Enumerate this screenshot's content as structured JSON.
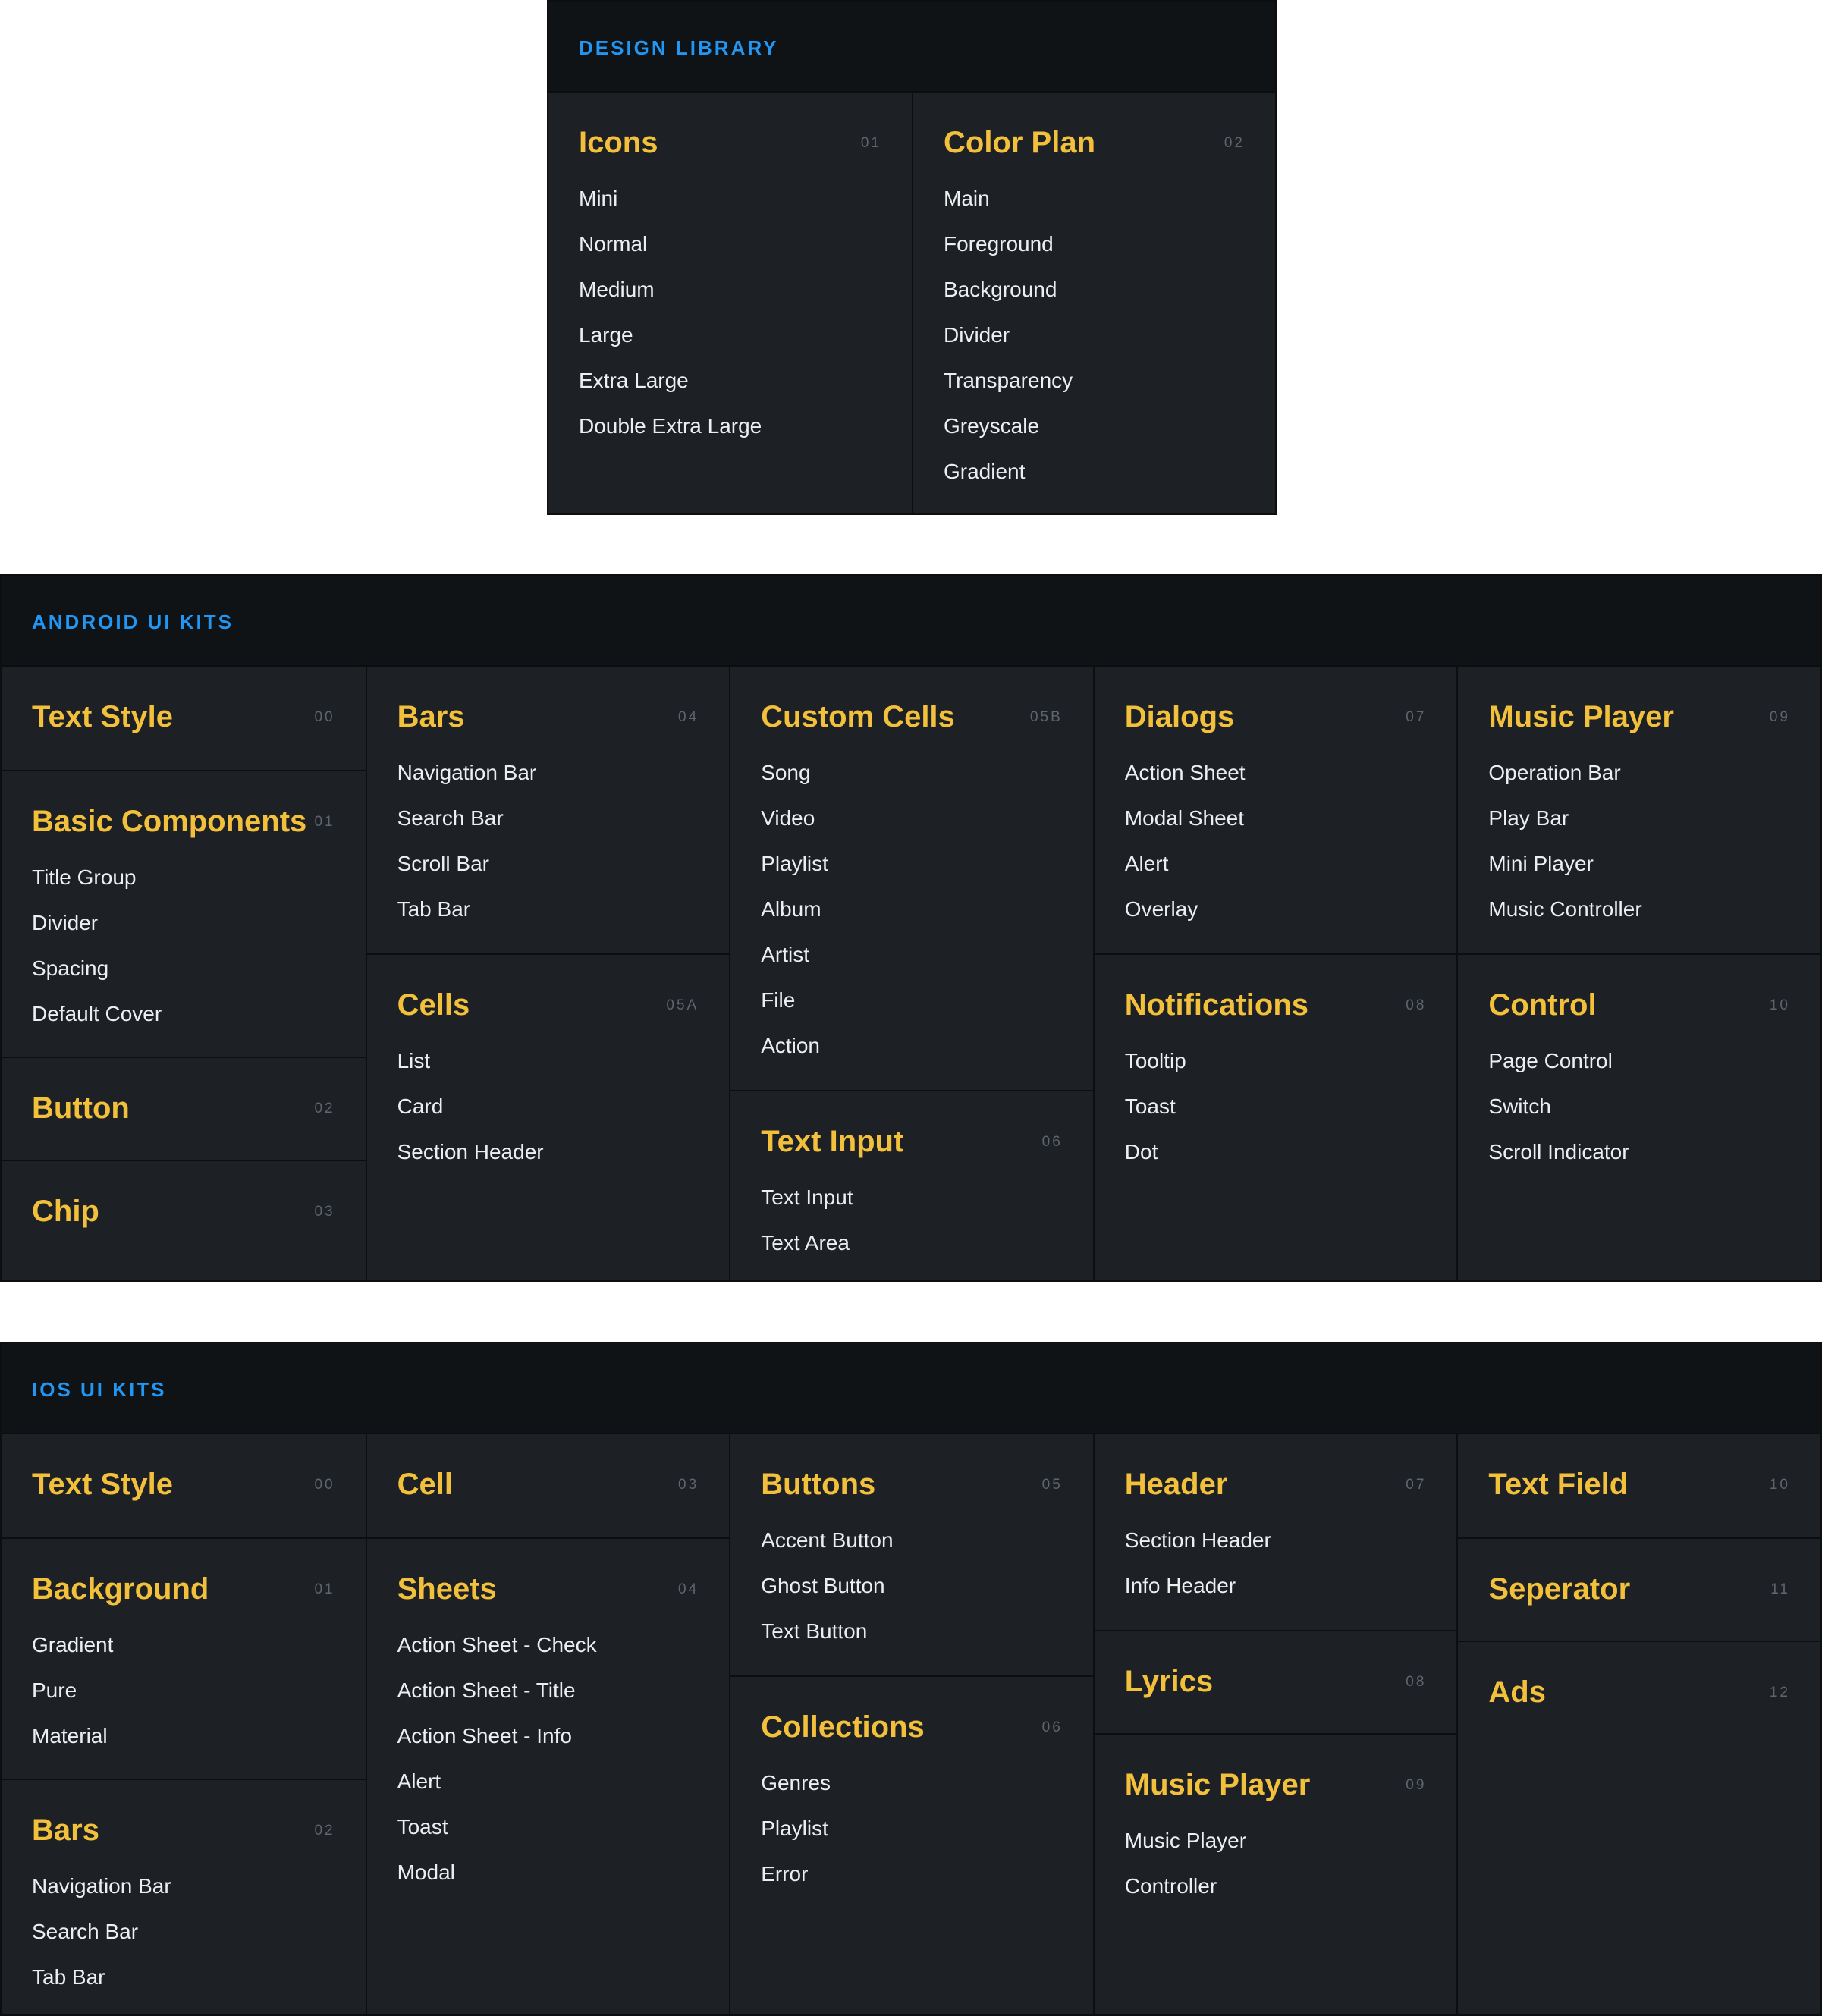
{
  "design_library": {
    "header": "DESIGN LIBRARY",
    "columns": [
      [
        {
          "title": "Icons",
          "num": "01",
          "items": [
            "Mini",
            "Normal",
            "Medium",
            "Large",
            "Extra Large",
            "Double Extra Large"
          ]
        }
      ],
      [
        {
          "title": "Color Plan",
          "num": "02",
          "items": [
            "Main",
            "Foreground",
            "Background",
            "Divider",
            "Transparency",
            "Greyscale",
            "Gradient"
          ]
        }
      ]
    ]
  },
  "android": {
    "header": "ANDROID UI KITS",
    "columns": [
      [
        {
          "title": "Text Style",
          "num": "00",
          "items": []
        },
        {
          "title": "Basic Components",
          "num": "01",
          "items": [
            "Title Group",
            "Divider",
            "Spacing",
            "Default Cover"
          ]
        },
        {
          "title": "Button",
          "num": "02",
          "items": []
        },
        {
          "title": "Chip",
          "num": "03",
          "items": []
        }
      ],
      [
        {
          "title": "Bars",
          "num": "04",
          "items": [
            "Navigation Bar",
            "Search Bar",
            "Scroll Bar",
            "Tab Bar"
          ]
        },
        {
          "title": "Cells",
          "num": "05A",
          "items": [
            "List",
            "Card",
            "Section Header"
          ]
        }
      ],
      [
        {
          "title": "Custom Cells",
          "num": "05B",
          "items": [
            "Song",
            "Video",
            "Playlist",
            "Album",
            "Artist",
            "File",
            "Action"
          ]
        },
        {
          "title": "Text Input",
          "num": "06",
          "items": [
            "Text Input",
            "Text Area"
          ]
        }
      ],
      [
        {
          "title": "Dialogs",
          "num": "07",
          "items": [
            "Action Sheet",
            "Modal Sheet",
            "Alert",
            "Overlay"
          ]
        },
        {
          "title": "Notifications",
          "num": "08",
          "items": [
            "Tooltip",
            "Toast",
            "Dot"
          ]
        }
      ],
      [
        {
          "title": "Music Player",
          "num": "09",
          "items": [
            "Operation Bar",
            "Play Bar",
            "Mini Player",
            "Music Controller"
          ]
        },
        {
          "title": "Control",
          "num": "10",
          "items": [
            "Page Control",
            "Switch",
            "Scroll Indicator"
          ]
        }
      ]
    ]
  },
  "ios": {
    "header": "IOS UI KITS",
    "columns": [
      [
        {
          "title": "Text Style",
          "num": "00",
          "items": []
        },
        {
          "title": "Background",
          "num": "01",
          "items": [
            "Gradient",
            "Pure",
            "Material"
          ]
        },
        {
          "title": "Bars",
          "num": "02",
          "items": [
            "Navigation Bar",
            "Search Bar",
            "Tab Bar"
          ]
        }
      ],
      [
        {
          "title": "Cell",
          "num": "03",
          "items": []
        },
        {
          "title": "Sheets",
          "num": "04",
          "items": [
            "Action Sheet - Check",
            "Action Sheet - Title",
            "Action Sheet - Info",
            "Alert",
            "Toast",
            "Modal"
          ]
        }
      ],
      [
        {
          "title": "Buttons",
          "num": "05",
          "items": [
            "Accent Button",
            "Ghost Button",
            "Text Button"
          ]
        },
        {
          "title": "Collections",
          "num": "06",
          "items": [
            "Genres",
            "Playlist",
            "Error"
          ]
        }
      ],
      [
        {
          "title": "Header",
          "num": "07",
          "items": [
            "Section Header",
            "Info Header"
          ]
        },
        {
          "title": "Lyrics",
          "num": "08",
          "items": []
        },
        {
          "title": "Music Player",
          "num": "09",
          "items": [
            "Music Player",
            "Controller"
          ]
        }
      ],
      [
        {
          "title": "Text Field",
          "num": "10",
          "items": []
        },
        {
          "title": "Seperator",
          "num": "11",
          "items": []
        },
        {
          "title": "Ads",
          "num": "12",
          "items": []
        }
      ]
    ]
  }
}
